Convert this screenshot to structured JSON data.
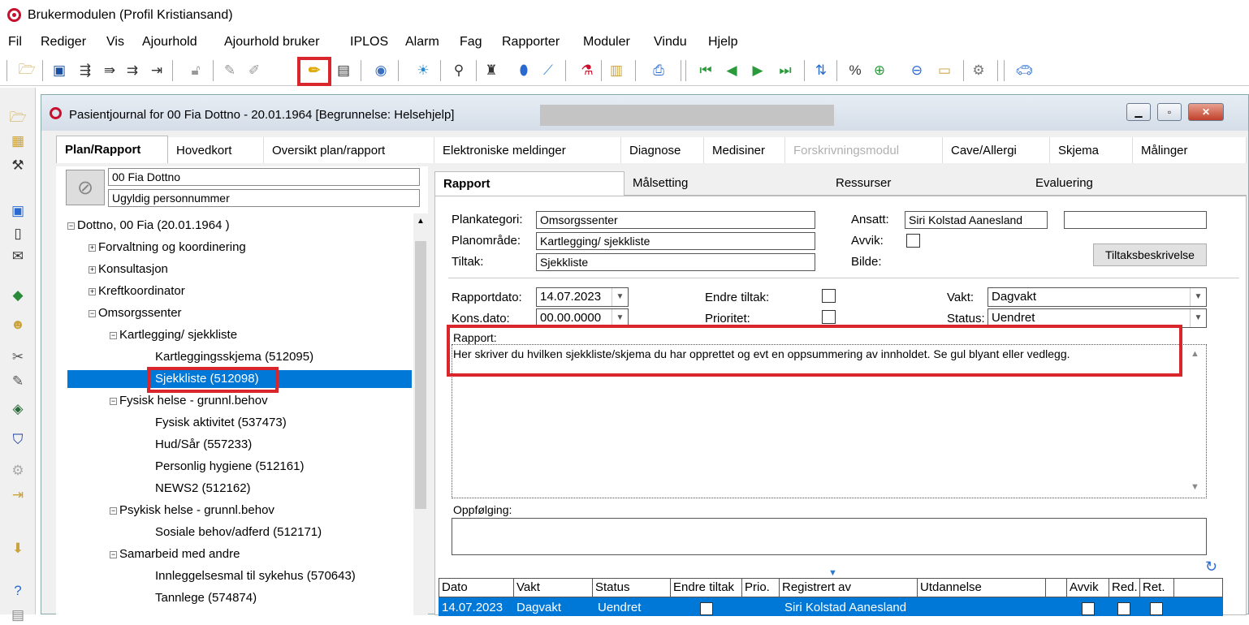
{
  "app": {
    "title": "Brukermodulen (Profil Kristiansand)"
  },
  "menu": [
    "Fil",
    "Rediger",
    "Vis",
    "Ajourhold",
    "Ajourhold bruker",
    "IPLOS",
    "Alarm",
    "Fag",
    "Rapporter",
    "Moduler",
    "Vindu",
    "Hjelp"
  ],
  "window": {
    "title": "Pasientjournal for 00 Fia Dottno - 20.01.1964   [Begrunnelse: Helsehjelp]"
  },
  "tabs": [
    "Plan/Rapport",
    "Hovedkort",
    "Oversikt plan/rapport",
    "Elektroniske meldinger",
    "Diagnose",
    "Medisiner",
    "Forskrivningsmodul",
    "Cave/Allergi",
    "Skjema",
    "Målinger"
  ],
  "patient": {
    "name": "00 Fia Dottno",
    "id_status": "Ugyldig personnummer"
  },
  "tree": [
    {
      "label": "Dottno, 00 Fia (20.01.1964 )",
      "level": 0,
      "toggle": "−"
    },
    {
      "label": "Forvaltning og koordinering",
      "level": 1,
      "toggle": "+"
    },
    {
      "label": "Konsultasjon",
      "level": 1,
      "toggle": "+"
    },
    {
      "label": "Kreftkoordinator",
      "level": 1,
      "toggle": "+"
    },
    {
      "label": "Omsorgssenter",
      "level": 1,
      "toggle": "−"
    },
    {
      "label": "Kartlegging/ sjekkliste",
      "level": 2,
      "toggle": "−"
    },
    {
      "label": "Kartleggingsskjema (512095)",
      "level": 3
    },
    {
      "label": "Sjekkliste (512098)",
      "level": 3,
      "selected": true
    },
    {
      "label": "Fysisk helse - grunnl.behov",
      "level": 2,
      "toggle": "−"
    },
    {
      "label": "Fysisk aktivitet (537473)",
      "level": 3
    },
    {
      "label": "Hud/Sår (557233)",
      "level": 3
    },
    {
      "label": "Personlig hygiene (512161)",
      "level": 3
    },
    {
      "label": "NEWS2 (512162)",
      "level": 3
    },
    {
      "label": "Psykisk helse - grunnl.behov",
      "level": 2,
      "toggle": "−"
    },
    {
      "label": "Sosiale behov/adferd (512171)",
      "level": 3
    },
    {
      "label": "Samarbeid med andre",
      "level": 2,
      "toggle": "−"
    },
    {
      "label": "Innleggelsesmal til sykehus (570643)",
      "level": 3
    },
    {
      "label": "Tannlege (574874)",
      "level": 3
    }
  ],
  "subtabs": [
    "Rapport",
    "Målsetting",
    "Ressurser",
    "Evaluering"
  ],
  "form": {
    "plankategori_label": "Plankategori:",
    "plankategori": "Omsorgssenter",
    "planomrade_label": "Planområde:",
    "planomrade": "Kartlegging/ sjekkliste",
    "tiltak_label": "Tiltak:",
    "tiltak": "Sjekkliste",
    "ansatt_label": "Ansatt:",
    "ansatt": "Siri Kolstad Aanesland",
    "avvik_label": "Avvik:",
    "bilde_label": "Bilde:",
    "tiltaksbeskrivelse": "Tiltaksbeskrivelse",
    "rapportdato_label": "Rapportdato:",
    "rapportdato": "14.07.2023",
    "konsdato_label": "Kons.dato:",
    "konsdato": "00.00.0000",
    "endre_tiltak_label": "Endre tiltak:",
    "prioritet_label": "Prioritet:",
    "vakt_label": "Vakt:",
    "vakt": "Dagvakt",
    "status_label": "Status:",
    "status": "Uendret",
    "rapport_label": "Rapport:",
    "rapport_text": "Her skriver du hvilken sjekkliste/skjema du har opprettet og evt en oppsummering av innholdet. Se gul blyant eller vedlegg.",
    "oppfolging_label": "Oppfølging:"
  },
  "grid": {
    "headers": [
      "Dato",
      "Vakt",
      "Status",
      "Endre tiltak",
      "Prio.",
      "Registrert av",
      "Utdannelse",
      "",
      "Avvik",
      "Red.",
      "Ret."
    ],
    "row": {
      "dato": "14.07.2023",
      "vakt": "Dagvakt",
      "status": "Uendret",
      "registrert": "Siri Kolstad Aanesland"
    }
  },
  "colors": {
    "highlight": "#d9262c",
    "selection": "#0078d7"
  }
}
